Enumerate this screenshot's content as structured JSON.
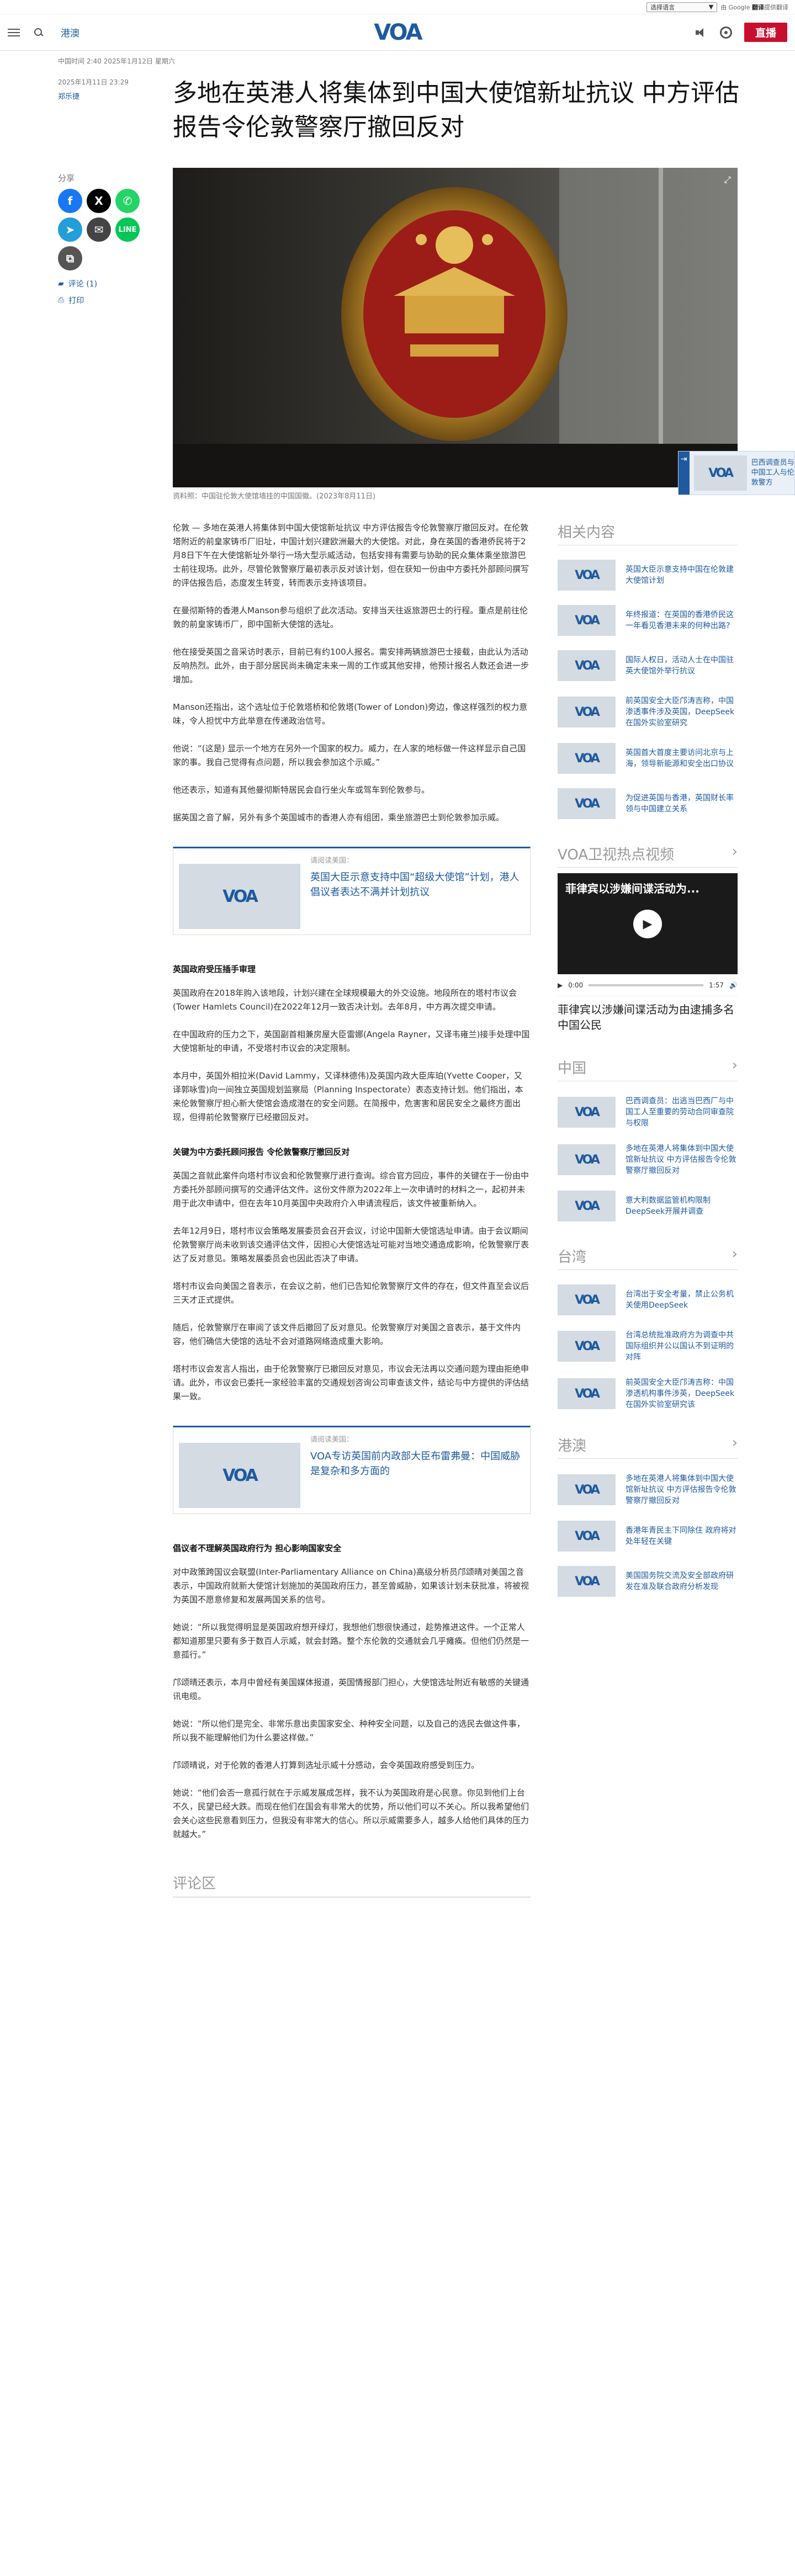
{
  "topbar": {
    "language_select": "选择语言",
    "google_prefix": "由 Google",
    "google_brand": "翻译",
    "google_suffix": "提供翻译",
    "select_arrow": "▼"
  },
  "header": {
    "section": "港澳",
    "logo": "VOA",
    "live_label": "直播"
  },
  "article": {
    "updated": "中国时间 2:40 2025年1月12日 星期六",
    "date": "2025年1月11日 23:29",
    "author": "郑乐捷",
    "title": "多地在英港人将集体到中国大使馆新址抗议 中方评估报告令伦敦警察厅撤回反对",
    "share_label": "分享",
    "comments_link": "评论 (1)",
    "print_link": "打印",
    "caption": "资料照：中国驻伦敦大使馆墙挂的中国国徽。(2023年8月11日)",
    "paragraphs": [
      "伦敦 — 多地在英港人将集体到中国大使馆新址抗议 中方评估报告令伦敦警察厅撤回反对。在伦敦塔附近的前皇家铸币厂旧址，中国计划兴建欧洲最大的大使馆。对此，身在英国的香港侨民将于2月8日下午在大使馆新址外举行一场大型示威活动，包括安排有需要与协助的民众集体乘坐旅游巴士前往现场。此外，尽管伦敦警察厅最初表示反对该计划，但在获知一份由中方委托外部顾问撰写的评估报告后，态度发生转变，转而表示支持该项目。",
      "在曼彻斯特的香港人Manson参与组织了此次活动。安排当天往返旅游巴士的行程。重点是前往伦敦的前皇家铸币厂，即中国新大使馆的选址。",
      "他在接受英国之音采访时表示，目前已有约100人报名。需安排两辆旅游巴士接载，由此认为活动反响热烈。此外，由于部分居民尚未确定未来一周的工作或其他安排，他预计报名人数还会进一步增加。",
      "Manson还指出，这个选址位于伦敦塔桥和伦敦塔(Tower of London)旁边，像这样强烈的权力意味，令人担忧中方此举意在传递政治信号。",
      "他说：“(这是) 显示一个地方在另外一个国家的权力。威力，在人家的地标做一件这样显示自己国家的事。我自己觉得有点问题，所以我会参加这个示威。”",
      "他还表示，知道有其他曼彻斯特居民会自行坐火车或驾车到伦敦参与。",
      "据英国之音了解，另外有多个英国城市的香港人亦有组团，乘坐旅游巴士到伦敦参加示威。",
      "英国政府在2018年购入该地段，计划兴建在全球规模最大的外交设施。地段所在的塔村市议会(Tower Hamlets Council)在2022年12月一致否决计划。去年8月，中方再次提交申请。",
      "在中国政府的压力之下，英国副首相兼房屋大臣雷娜(Angela Rayner，又译韦雍兰)接手处理中国大使馆新址的申请，不受塔村市议会的决定限制。",
      "本月中，英国外相拉米(David Lammy，又译林德伟)及英国内政大臣库珀(Yvette Cooper，又译郭咏雪)向一间独立英国规划监察局（Planning Inspectorate）表态支持计划。他们指出，本来伦敦警察厅担心新大使馆会造成潜在的安全问题。在简报中，危害害和居民安全之最终方面出现，但得前伦敦警察厅已经撤回反对。",
      "英国之音就此案件向塔村市议会和伦敦警察厅进行查询。综合官方回应，事件的关键在于一份由中方委托外部顾问撰写的交通评估文件。这份文件原为2022年上一次申请时的材料之一，起初并未用于此次申请中，但在去年10月英国中央政府介入申请流程后，该文件被重新纳入。",
      "去年12月9日，塔村市议会策略发展委员会召开会议，讨论中国新大使馆选址申请。由于会议期间伦敦警察厅尚未收到该交通评估文件，因担心大使馆选址可能对当地交通造成影响，伦敦警察厅表达了反对意见。策略发展委员会也因此否决了申请。",
      "塔村市议会向美国之音表示，在会议之前，他们已告知伦敦警察厅文件的存在，但文件直至会议后三天才正式提供。",
      "随后，伦敦警察厅在审阅了该文件后撤回了反对意见。伦敦警察厅对美国之音表示，基于文件内容，他们确信大使馆的选址不会对道路网络造成重大影响。",
      "塔村市议会发言人指出，由于伦敦警察厅已撤回反对意见，市议会无法再以交通问题为理由拒绝申请。此外，市议会已委托一家经验丰富的交通规划咨询公司审查该文件，结论与中方提供的评估结果一致。",
      "对中政策跨国议会联盟(Inter-Parliamentary Alliance on China)高级分析员邝颂晴对美国之音表示，中国政府就新大使馆计划施加的英国政府压力，甚至曾威胁，如果该计划未获批准，将被视为英国不愿意修复和发展两国关系的信号。",
      "她说：“所以我觉得明显是英国政府想开绿灯，我想他们想很快通过，趁势推进这件。一个正常人都知道那里只要有多于数百人示威，就会封路。整个东伦敦的交通就会几乎瘫痪。但他们仍然是一意孤行。”",
      "邝颂晴还表示，本月中曾经有美国媒体报道，英国情报部门担心，大使馆选址附近有敏感的关键通讯电缆。",
      "她说：“所以他们是完全、非常乐意出卖国家安全、种种安全问题，以及自己的选民去做这件事，所以我不能理解他们为什么要这样做。”",
      "邝颂晴说，对于伦敦的香港人打算到选址示威十分感动，会令英国政府感受到压力。",
      "她说：“他们会否一意孤行就在于示威发展成怎样，我不认为英国政府是心民意。你见到他们上台不久，民望已经大跌。而现在他们在国会有非常大的优势，所以他们可以不关心。所以我希望他们会关心这些民意看到压力，但我没有非常大的信心。所以示威需要多人，越多人给他们具体的压力就越大。”"
    ],
    "headings": [
      "英国政府受压插手审理",
      "关键为中方委托顾问报告 令伦敦警察厅撤回反对",
      "倡议者不理解英国政府行为 担心影响国家安全"
    ],
    "related_cards": [
      {
        "label": "请阅读美国：",
        "title": "英国大臣示意支持中国“超级大使馆”计划，港人倡议者表达不满并计划抗议"
      },
      {
        "label": "请阅读美国：",
        "title": "VOA专访英国前内政部大臣布雷弗曼：中国威胁是复杂和多方面的"
      }
    ],
    "comments_heading": "评论区"
  },
  "popup": {
    "text": "巴西调查员与中国工人与伦敦警方"
  },
  "rail": {
    "related_heading": "相关内容",
    "related": [
      "英国大臣示意支持中国在伦敦建大使馆计划",
      "年终报道：在英国的香港侨民这一年看见香港未来的何种出路?",
      "国际人权日，活动人士在中国驻英大使馆外举行抗议",
      "前英国安全大臣邝涛吉称，中国渗透事件涉及英国，DeepSeek在国外实验室研究",
      "英国首大首度主要访问北京与上海，领导新能源和安全出口协议",
      "为促进英国与香港，英国财长率领与中国建立关系"
    ],
    "video_heading": "VOA卫视热点视频",
    "video_overlay": "菲律宾以涉嫌间谍活动为...",
    "video_time": "0:00",
    "video_duration": "1:57",
    "video_title": "菲律宾以涉嫌间谍活动为由逮捕多名中国公民",
    "china_heading": "中国",
    "china": [
      "巴西调查员：出逃当巴西厂与中国工人至重要的劳动合同审查院与权限",
      "多地在英港人将集体到中国大使馆新址抗议 中方评估报告令伦敦警察厅撤回反对",
      "意大利数据监管机构限制DeepSeek开展并调查"
    ],
    "taiwan_heading": "台湾",
    "taiwan": [
      "台湾出于安全考量，禁止公务机关使用DeepSeek",
      "台湾总统批准政府方为调查中共国际组织并公以国认不到证明的对阵",
      "前英国安全大臣邝涛吉称：中国渗透机构事件涉英，DeepSeek在国外实验室研究该"
    ],
    "hk_heading": "港澳",
    "hk": [
      "多地在英港人将集体到中国大使馆新址抗议 中方评估报告令伦敦警察厅撤回反对",
      "香港年青民主下同除住 政府将对处年轻在关键",
      "美国国务院交流及安全部政府研发在准及联合政府分析发现"
    ]
  },
  "colors": {
    "accent": "#1e5aa0",
    "live": "#c8102e"
  },
  "icons": [
    "menu-icon",
    "search-icon",
    "speaker-icon",
    "radio-icon",
    "expand-icon",
    "facebook-icon",
    "x-icon",
    "whatsapp-icon",
    "telegram-icon",
    "email-icon",
    "line-icon",
    "copy-link-icon",
    "comment-icon",
    "print-icon",
    "play-icon",
    "chevron-right-icon"
  ]
}
